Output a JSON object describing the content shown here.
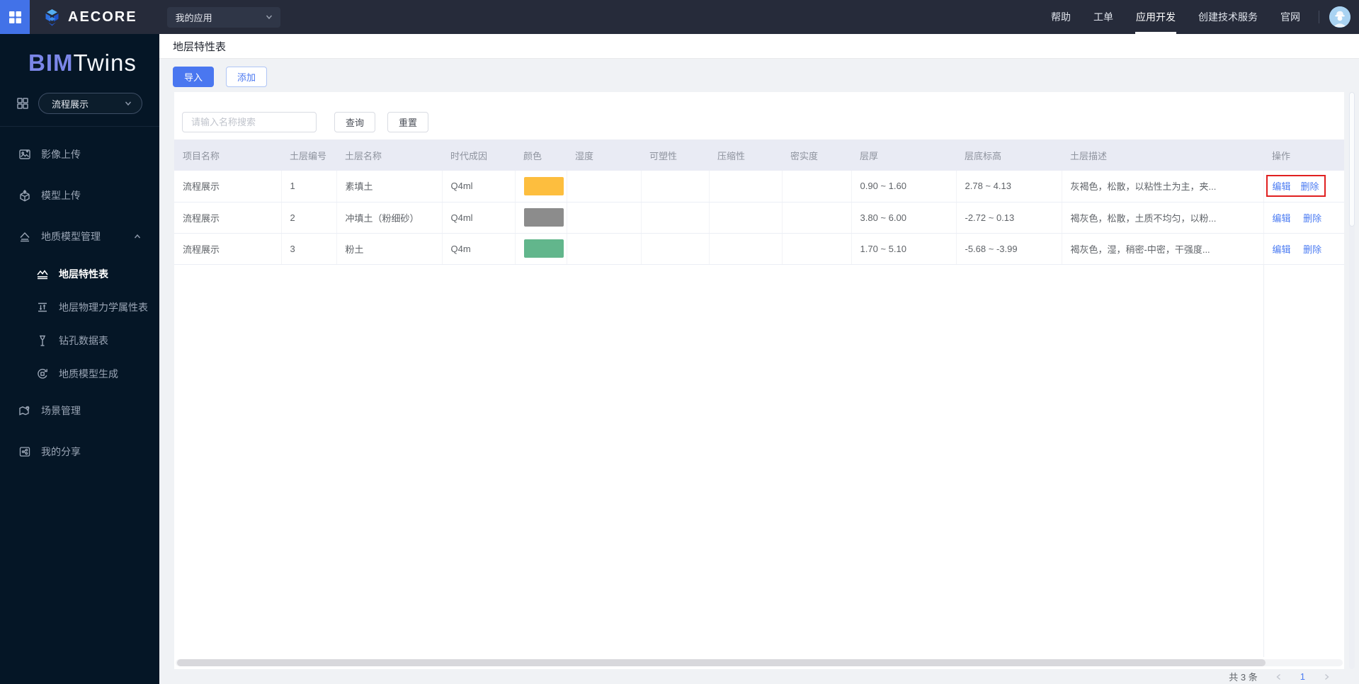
{
  "topbar": {
    "brand": "AECORE",
    "app_select_value": "我的应用",
    "nav": [
      {
        "label": "帮助"
      },
      {
        "label": "工单"
      },
      {
        "label": "应用开发",
        "active": true
      },
      {
        "label": "创建技术服务"
      },
      {
        "label": "官网"
      }
    ]
  },
  "sidebar": {
    "logo_primary": "BIM",
    "logo_secondary": "Twins",
    "project_select_value": "流程展示",
    "menu": {
      "image_upload": "影像上传",
      "model_upload": "模型上传",
      "geology_group": "地质模型管理",
      "strata_table": "地层特性表",
      "physics_table": "地层物理力学属性表",
      "drill_table": "钻孔数据表",
      "model_generate": "地质模型生成",
      "scene_manage": "场景管理",
      "my_share": "我的分享"
    }
  },
  "page": {
    "title": "地层特性表",
    "import_button": "导入",
    "add_button": "添加",
    "search_placeholder": "请输入名称搜索",
    "query_button": "查询",
    "reset_button": "重置"
  },
  "table": {
    "columns": [
      "项目名称",
      "土层编号",
      "土层名称",
      "时代成因",
      "颜色",
      "湿度",
      "可塑性",
      "压缩性",
      "密实度",
      "层厚",
      "层底标高",
      "土层描述",
      "操作"
    ],
    "rows": [
      {
        "project": "流程展示",
        "layer_no": "1",
        "layer_name": "素填土",
        "era": "Q4ml",
        "color": "#FDBE3E",
        "humidity": "",
        "plasticity": "",
        "compressibility": "",
        "density": "",
        "thickness": "0.90 ~ 1.60",
        "bottom_elevation": "2.78 ~ 4.13",
        "description": "灰褐色，松散，以粘性土为主，夹...",
        "edit": "编辑",
        "delete": "删除",
        "highlighted": true
      },
      {
        "project": "流程展示",
        "layer_no": "2",
        "layer_name": "冲填土（粉细砂）",
        "era": "Q4ml",
        "color": "#8C8C8C",
        "humidity": "",
        "plasticity": "",
        "compressibility": "",
        "density": "",
        "thickness": "3.80 ~ 6.00",
        "bottom_elevation": "-2.72 ~ 0.13",
        "description": "褐灰色，松散，土质不均匀，以粉...",
        "edit": "编辑",
        "delete": "删除",
        "highlighted": false
      },
      {
        "project": "流程展示",
        "layer_no": "3",
        "layer_name": "粉土",
        "era": "Q4m",
        "color": "#62B68C",
        "humidity": "",
        "plasticity": "",
        "compressibility": "",
        "density": "",
        "thickness": "1.70 ~ 5.10",
        "bottom_elevation": "-5.68 ~ -3.99",
        "description": "褐灰色，湿，稍密-中密，干强度...",
        "edit": "编辑",
        "delete": "删除",
        "highlighted": false
      }
    ]
  },
  "pagination": {
    "total": "共 3 条",
    "current_page": "1"
  },
  "colors": {
    "primary": "#4A77F0",
    "highlight_box": "#E02020",
    "header_row_bg": "#E9EBF4"
  }
}
